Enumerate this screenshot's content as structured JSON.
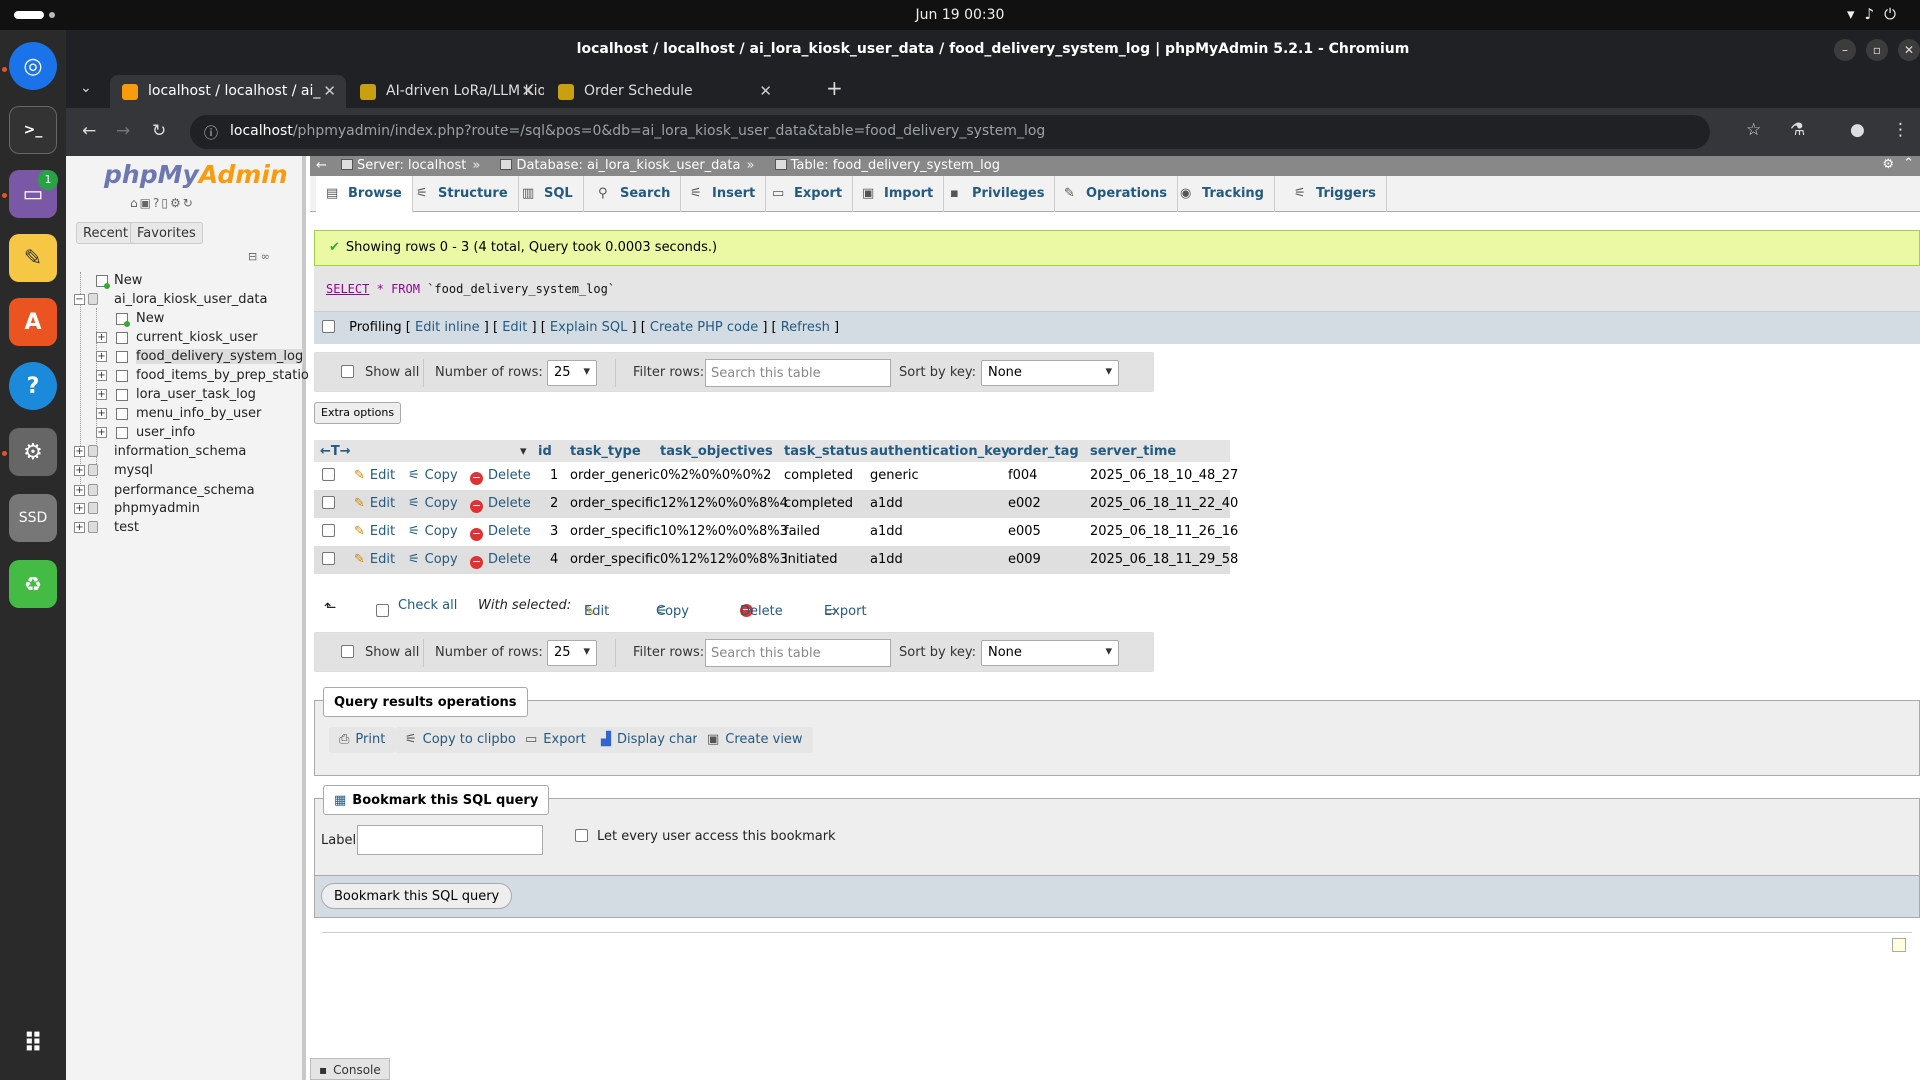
{
  "system": {
    "clock": "Jun 19  00:30",
    "dock_badge": "1",
    "ssd_label": "SSD"
  },
  "window": {
    "title": "localhost / localhost / ai_lora_kiosk_user_data / food_delivery_system_log | phpMyAdmin 5.2.1 - Chromium"
  },
  "tabs": [
    {
      "label": "localhost / localhost / ai_"
    },
    {
      "label": "AI-driven LoRa/LLM Kiosl"
    },
    {
      "label": "Order Schedule"
    }
  ],
  "address": {
    "host": "localhost",
    "path": "/phpmyadmin/index.php?route=/sql&pos=0&db=ai_lora_kiosk_user_data&table=food_delivery_system_log"
  },
  "nav": {
    "logo_php": "php",
    "logo_my": "My",
    "logo_admin": "Admin",
    "recent": "Recent",
    "favorites": "Favorites",
    "tree": {
      "new_root": "New",
      "db": "ai_lora_kiosk_user_data",
      "new_db": "New",
      "tables": [
        "current_kiosk_user",
        "food_delivery_system_log",
        "food_items_by_prep_station",
        "lora_user_task_log",
        "menu_info_by_user",
        "user_info"
      ],
      "other_dbs": [
        "information_schema",
        "mysql",
        "performance_schema",
        "phpmyadmin",
        "test"
      ]
    }
  },
  "breadcrumb": {
    "server": "Server: localhost",
    "database": "Database: ai_lora_kiosk_user_data",
    "table": "Table: food_delivery_system_log"
  },
  "menu": [
    "Browse",
    "Structure",
    "SQL",
    "Search",
    "Insert",
    "Export",
    "Import",
    "Privileges",
    "Operations",
    "Tracking",
    "Triggers"
  ],
  "message": "Showing rows 0 - 3 (4 total, Query took 0.0003 seconds.)",
  "sql": {
    "select": "SELECT",
    "star": "*",
    "from": "FROM",
    "table": "`food_delivery_system_log`"
  },
  "profiling": {
    "label": "Profiling",
    "edit_inline": "Edit inline",
    "edit": "Edit",
    "explain": "Explain SQL",
    "php": "Create PHP code",
    "refresh": "Refresh"
  },
  "navtable": {
    "show_all": "Show all",
    "num_rows_label": "Number of rows:",
    "num_rows": "25",
    "filter_label": "Filter rows:",
    "filter_placeholder": "Search this table",
    "sort_label": "Sort by key:",
    "sort_value": "None"
  },
  "extra_options": "Extra options",
  "columns": [
    "id",
    "task_type",
    "task_objectives",
    "task_status",
    "authentication_key",
    "order_tag",
    "server_time"
  ],
  "row_actions": {
    "edit": "Edit",
    "copy": "Copy",
    "delete": "Delete"
  },
  "rows": [
    {
      "id": "1",
      "task_type": "order_generic",
      "task_objectives": "0%2%0%0%0%2",
      "task_status": "completed",
      "authentication_key": "generic",
      "order_tag": "f004",
      "server_time": "2025_06_18_10_48_27"
    },
    {
      "id": "2",
      "task_type": "order_specific",
      "task_objectives": "12%12%0%0%8%4",
      "task_status": "completed",
      "authentication_key": "a1dd",
      "order_tag": "e002",
      "server_time": "2025_06_18_11_22_40"
    },
    {
      "id": "3",
      "task_type": "order_specific",
      "task_objectives": "10%12%0%0%8%3",
      "task_status": "failed",
      "authentication_key": "a1dd",
      "order_tag": "e005",
      "server_time": "2025_06_18_11_26_16"
    },
    {
      "id": "4",
      "task_type": "order_specific",
      "task_objectives": "0%12%12%0%8%3",
      "task_status": "initiated",
      "authentication_key": "a1dd",
      "order_tag": "e009",
      "server_time": "2025_06_18_11_29_58"
    }
  ],
  "with_selected": {
    "check_all": "Check all",
    "label": "With selected:",
    "edit": "Edit",
    "copy": "Copy",
    "delete": "Delete",
    "export": "Export"
  },
  "query_ops": {
    "legend": "Query results operations",
    "print": "Print",
    "clipboard": "Copy to clipboard",
    "export": "Export",
    "chart": "Display chart",
    "view": "Create view"
  },
  "bookmark": {
    "legend": "Bookmark this SQL query",
    "label": "Label:",
    "every_user": "Let every user access this bookmark",
    "button": "Bookmark this SQL query"
  },
  "console": "Console"
}
